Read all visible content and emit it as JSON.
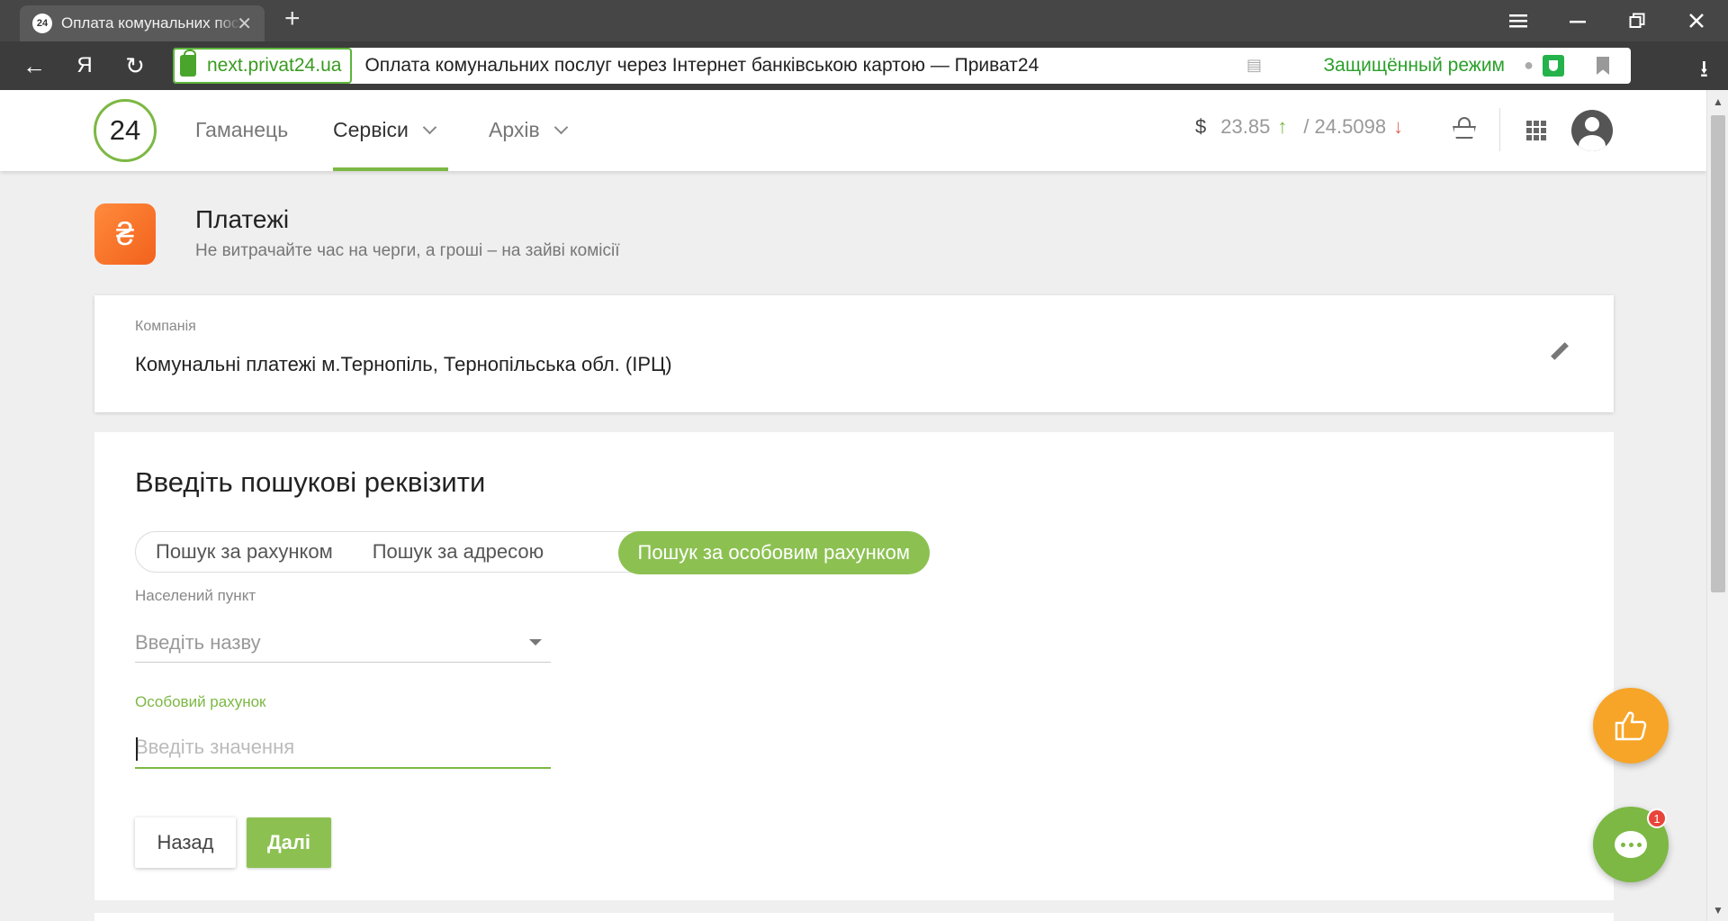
{
  "browser": {
    "tab_title": "Оплата комунальних послуг",
    "tab_favicon": "24",
    "url_domain": "next.privat24.ua",
    "page_title": "Оплата комунальних послуг через Інтернет банківською картою — Приват24",
    "secure_mode": "Защищённый режим",
    "yandex_label": "Я"
  },
  "nav": {
    "logo": "24",
    "items": [
      "Гаманець",
      "Сервіси",
      "Архів"
    ],
    "active": "Сервіси"
  },
  "rates": {
    "currency": "$",
    "buy": "23.85",
    "sell": "/ 24.5098"
  },
  "payments": {
    "icon": "₴",
    "title": "Платежі",
    "subtitle": "Не витрачайте час на черги, а гроші – на зайві комісії"
  },
  "company": {
    "label": "Компанія",
    "name": "Комунальні платежі м.Тернопіль, Тернопільська обл. (ІРЦ)"
  },
  "search": {
    "title": "Введіть пошукові реквізити",
    "tabs": [
      "Пошук за рахунком",
      "Пошук за адресою",
      "Пошук за особовим рахунком"
    ],
    "active_tab": "Пошук за особовим рахунком",
    "city_label": "Населений пункт",
    "city_placeholder": "Введіть назву",
    "account_label": "Особовий рахунок",
    "account_placeholder": "Введіть значення",
    "back_button": "Назад",
    "next_button": "Далі"
  },
  "chat": {
    "badge": "1"
  },
  "colors": {
    "brand_green": "#8cc152",
    "payment_orange": "#f2621c",
    "like_orange": "#f7a528",
    "rate_up": "#7cb843",
    "rate_down": "#e2675b"
  }
}
